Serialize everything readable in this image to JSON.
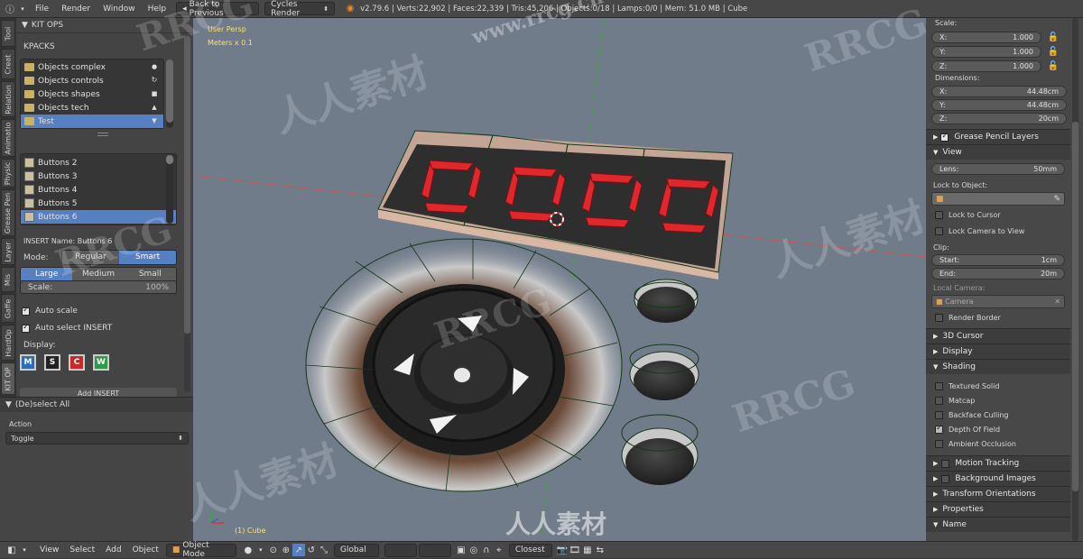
{
  "topbar": {
    "menus": [
      "File",
      "Render",
      "Window",
      "Help"
    ],
    "back_label": "Back to Previous",
    "engine": "Cycles Render",
    "stats": "v2.79.6 | Verts:22,902 | Faces:22,339 | Tris:45,206 | Objects:0/18 | Lamps:0/0 | Mem: 51.0 MB | Cube"
  },
  "vtabs": [
    "Tool",
    "Creat",
    "Relation",
    "Animatio",
    "Physic",
    "Grease Pen",
    "Layer",
    "Mis",
    "Gaffe",
    "HardOp",
    "KIT OP"
  ],
  "left": {
    "panel_title": "KIT OPS",
    "kpacks_label": "KPACKS",
    "kpacks": [
      "Objects complex",
      "Objects controls",
      "Objects shapes",
      "Objects tech",
      "Test"
    ],
    "kpacks_selected": 4,
    "inserts": [
      "Buttons 2",
      "Buttons 3",
      "Buttons 4",
      "Buttons 5",
      "Buttons 6"
    ],
    "inserts_selected": 4,
    "insert_name": "INSERT Name: Buttons 6",
    "mode_label": "Mode:",
    "mode_options": [
      "Regular",
      "Smart"
    ],
    "mode_selected": 1,
    "size_options": [
      "Large",
      "Medium",
      "Small"
    ],
    "size_selected": 0,
    "scale_label": "Scale:",
    "scale_value": "100%",
    "auto_scale": "Auto scale",
    "auto_select": "Auto select INSERT",
    "display_label": "Display:",
    "display_icons": [
      "M",
      "S",
      "C",
      "W"
    ],
    "add_insert": "Add INSERT",
    "operator_title": "(De)select All",
    "action_label": "Action",
    "action_value": "Toggle"
  },
  "viewport": {
    "view_name": "User Persp",
    "units": "Meters x 0.1",
    "object_label": "(1) Cube"
  },
  "right": {
    "scale_label": "Scale:",
    "scale": [
      {
        "axis": "X:",
        "value": "1.000"
      },
      {
        "axis": "Y:",
        "value": "1.000"
      },
      {
        "axis": "Z:",
        "value": "1.000"
      }
    ],
    "dimensions_label": "Dimensions:",
    "dimensions": [
      {
        "axis": "X:",
        "value": "44.48cm"
      },
      {
        "axis": "Y:",
        "value": "44.48cm"
      },
      {
        "axis": "Z:",
        "value": "20cm"
      }
    ],
    "grease_pencil": "Grease Pencil Layers",
    "view_header": "View",
    "lens_label": "Lens:",
    "lens_value": "50mm",
    "lock_to_object": "Lock to Object:",
    "lock_to_cursor": "Lock to Cursor",
    "lock_camera": "Lock Camera to View",
    "clip_label": "Clip:",
    "clip_start_label": "Start:",
    "clip_start": "1cm",
    "clip_end_label": "End:",
    "clip_end": "20m",
    "local_camera": "Local Camera:",
    "camera_value": "Camera",
    "render_border": "Render Border",
    "cursor_header": "3D Cursor",
    "display_header": "Display",
    "shading_header": "Shading",
    "shading_options": [
      "Textured Solid",
      "Matcap",
      "Backface Culling",
      "Depth Of Field",
      "Ambient Occlusion"
    ],
    "shading_checked": [
      false,
      false,
      false,
      true,
      false
    ],
    "motion_tracking": "Motion Tracking",
    "background_images": "Background Images",
    "transform_orientations": "Transform Orientations",
    "properties": "Properties",
    "name": "Name"
  },
  "bottombar": {
    "menus": [
      "View",
      "Select",
      "Add",
      "Object"
    ],
    "mode": "Object Mode",
    "orientation": "Global",
    "snap": "Closest"
  },
  "watermarks": [
    "RRCG",
    "人人素材",
    "www.rrcg.cn"
  ],
  "colors": {
    "selection": "#5680c2",
    "segment_red": "#e0282c",
    "viewport_bg": "#717c8b"
  }
}
